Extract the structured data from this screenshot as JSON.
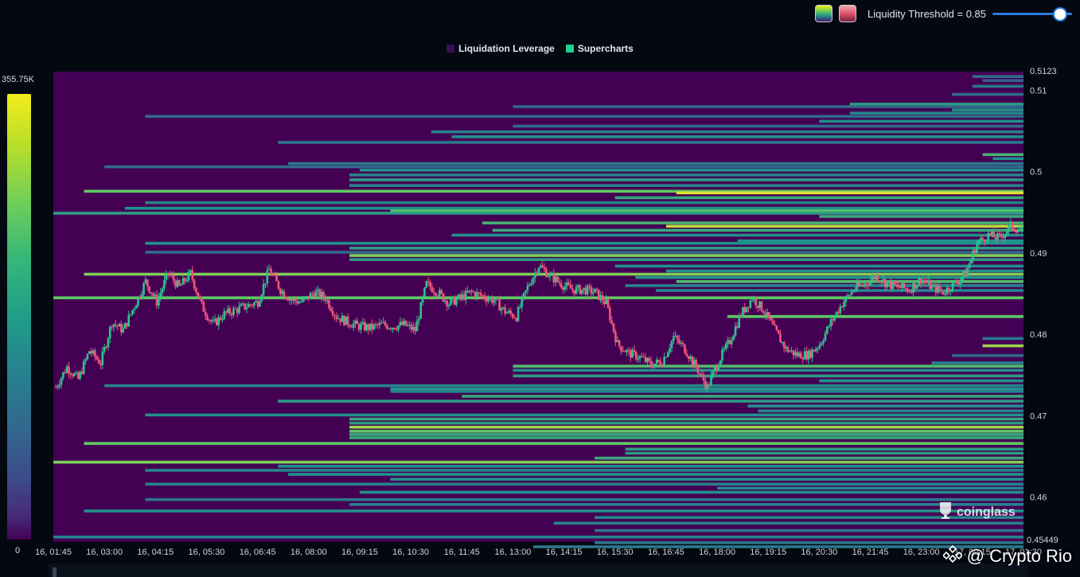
{
  "toolbar": {
    "threshold_label": "Liquidity Threshold = 0.85",
    "threshold_value": 0.85,
    "colormap_icons": [
      "viridis-colormap-icon",
      "red-colormap-icon"
    ]
  },
  "colorbar": {
    "max_label": "355.75K",
    "min_label": "0"
  },
  "watermark": "coinglass",
  "credit": "@ Crypto Rio",
  "colors": {
    "background": "#440154",
    "candle_up": "#2ec38d",
    "candle_down": "#f0567a",
    "legend_liquidation": "#3b0f57",
    "legend_supercharts": "#1fcf90"
  },
  "chart_data": {
    "type": "heatmap",
    "legend": [
      {
        "name": "Liquidation Leverage",
        "color": "#3b0f57"
      },
      {
        "name": "Supercharts",
        "color": "#1fcf90"
      }
    ],
    "x_ticks": [
      "16, 01:45",
      "16, 03:00",
      "16, 04:15",
      "16, 05:30",
      "16, 06:45",
      "16, 08:00",
      "16, 09:15",
      "16, 10:30",
      "16, 11:45",
      "16, 13:00",
      "16, 14:15",
      "16, 15:30",
      "16, 16:45",
      "16, 18:00",
      "16, 19:15",
      "16, 20:30",
      "16, 21:45",
      "16, 23:00",
      "17, 00:15",
      "17, 01:30"
    ],
    "y_ticks": [
      0.46,
      0.47,
      0.48,
      0.49,
      0.5,
      0.51
    ],
    "ylim": [
      0.45449,
      0.5123
    ],
    "y_range_labels": [
      "0.5123",
      "0.45449"
    ],
    "colorscale": {
      "min": 0,
      "max": 355750
    },
    "price_path": [
      0.4735,
      0.476,
      0.4745,
      0.478,
      0.4765,
      0.4815,
      0.4805,
      0.4835,
      0.4865,
      0.484,
      0.4875,
      0.4858,
      0.4875,
      0.4835,
      0.4812,
      0.4825,
      0.483,
      0.4835,
      0.484,
      0.488,
      0.4855,
      0.4842,
      0.484,
      0.4852,
      0.4845,
      0.4822,
      0.4815,
      0.481,
      0.4808,
      0.4812,
      0.481,
      0.4812,
      0.4805,
      0.4862,
      0.4852,
      0.4838,
      0.4845,
      0.4852,
      0.4847,
      0.4842,
      0.4828,
      0.4822,
      0.4858,
      0.4885,
      0.4872,
      0.4862,
      0.4855,
      0.4855,
      0.4852,
      0.4838,
      0.4788,
      0.4777,
      0.4772,
      0.4763,
      0.4767,
      0.4797,
      0.4782,
      0.476,
      0.4735,
      0.4767,
      0.4792,
      0.4825,
      0.4845,
      0.483,
      0.4805,
      0.4782,
      0.4775,
      0.4775,
      0.4788,
      0.4815,
      0.4838,
      0.4855,
      0.4862,
      0.4872,
      0.4862,
      0.4858,
      0.4855,
      0.4868,
      0.4858,
      0.4852,
      0.4862,
      0.4875,
      0.4912,
      0.4922,
      0.4918,
      0.4933,
      0.4928
    ],
    "liquidity_levels": [
      {
        "price": 0.5117,
        "from": "17, 00:15",
        "intensity": 0.35
      },
      {
        "price": 0.5112,
        "from": "17, 00:30",
        "intensity": 0.3
      },
      {
        "price": 0.5105,
        "from": "17, 00:15",
        "intensity": 0.4
      },
      {
        "price": 0.5095,
        "from": "16, 23:45",
        "intensity": 0.35
      },
      {
        "price": 0.5083,
        "from": "16, 21:15",
        "intensity": 0.55
      },
      {
        "price": 0.508,
        "from": "16, 13:00",
        "intensity": 0.35
      },
      {
        "price": 0.5076,
        "from": "16, 23:45",
        "intensity": 0.5
      },
      {
        "price": 0.5072,
        "from": "16, 21:15",
        "intensity": 0.45
      },
      {
        "price": 0.5068,
        "from": "16, 04:00",
        "intensity": 0.35
      },
      {
        "price": 0.5062,
        "from": "16, 20:30",
        "intensity": 0.5
      },
      {
        "price": 0.5056,
        "from": "16, 13:00",
        "intensity": 0.35
      },
      {
        "price": 0.5049,
        "from": "16, 11:00",
        "intensity": 0.45
      },
      {
        "price": 0.5043,
        "from": "16, 11:30",
        "intensity": 0.5
      },
      {
        "price": 0.5036,
        "from": "16, 07:15",
        "intensity": 0.4
      },
      {
        "price": 0.5021,
        "from": "17, 00:30",
        "intensity": 0.65
      },
      {
        "price": 0.5016,
        "from": "17, 00:45",
        "intensity": 0.5
      },
      {
        "price": 0.501,
        "from": "16, 07:30",
        "intensity": 0.4
      },
      {
        "price": 0.5006,
        "from": "16, 03:00",
        "intensity": 0.35
      },
      {
        "price": 0.5002,
        "from": "16, 09:15",
        "intensity": 0.5
      },
      {
        "price": 0.4996,
        "from": "16, 09:00",
        "intensity": 0.45
      },
      {
        "price": 0.499,
        "from": "16, 09:00",
        "intensity": 0.55
      },
      {
        "price": 0.4983,
        "from": "16, 09:00",
        "intensity": 0.45
      },
      {
        "price": 0.4976,
        "from": "16, 02:30",
        "intensity": 0.75
      },
      {
        "price": 0.4974,
        "from": "16, 17:00",
        "intensity": 0.95
      },
      {
        "price": 0.4968,
        "from": "16, 15:30",
        "intensity": 0.6
      },
      {
        "price": 0.4962,
        "from": "16, 04:00",
        "intensity": 0.45
      },
      {
        "price": 0.4955,
        "from": "16, 03:30",
        "intensity": 0.5
      },
      {
        "price": 0.4952,
        "from": "16, 10:00",
        "intensity": 0.7
      },
      {
        "price": 0.4949,
        "from": "16, 01:30",
        "intensity": 0.55
      },
      {
        "price": 0.4945,
        "from": "16, 20:30",
        "intensity": 0.6
      },
      {
        "price": 0.4937,
        "from": "16, 12:15",
        "intensity": 0.65
      },
      {
        "price": 0.4933,
        "from": "16, 16:45",
        "intensity": 0.9
      },
      {
        "price": 0.4928,
        "from": "16, 12:30",
        "intensity": 0.6
      },
      {
        "price": 0.4922,
        "from": "16, 11:30",
        "intensity": 0.5
      },
      {
        "price": 0.4915,
        "from": "16, 18:30",
        "intensity": 0.5
      },
      {
        "price": 0.4912,
        "from": "16, 04:00",
        "intensity": 0.5
      },
      {
        "price": 0.4906,
        "from": "16, 09:00",
        "intensity": 0.55
      },
      {
        "price": 0.4901,
        "from": "16, 04:00",
        "intensity": 0.35
      },
      {
        "price": 0.4897,
        "from": "16, 09:00",
        "intensity": 0.8
      },
      {
        "price": 0.4892,
        "from": "16, 09:00",
        "intensity": 0.55
      },
      {
        "price": 0.4884,
        "from": "16, 15:30",
        "intensity": 0.5
      },
      {
        "price": 0.4878,
        "from": "16, 16:45",
        "intensity": 0.5
      },
      {
        "price": 0.4874,
        "from": "16, 02:30",
        "intensity": 0.8
      },
      {
        "price": 0.487,
        "from": "16, 16:00",
        "intensity": 0.5
      },
      {
        "price": 0.4865,
        "from": "16, 17:00",
        "intensity": 0.7
      },
      {
        "price": 0.486,
        "from": "16, 15:45",
        "intensity": 0.45
      },
      {
        "price": 0.4854,
        "from": "16, 16:30",
        "intensity": 0.45
      },
      {
        "price": 0.4845,
        "from": "16, 01:45",
        "intensity": 0.75
      },
      {
        "price": 0.4822,
        "from": "16, 18:15",
        "intensity": 0.75
      },
      {
        "price": 0.4795,
        "from": "17, 00:30",
        "intensity": 0.4
      },
      {
        "price": 0.4786,
        "from": "17, 00:30",
        "intensity": 0.85
      },
      {
        "price": 0.4774,
        "from": "16, 23:45",
        "intensity": 0.35
      },
      {
        "price": 0.4765,
        "from": "16, 23:15",
        "intensity": 0.45
      },
      {
        "price": 0.4761,
        "from": "16, 13:00",
        "intensity": 0.7
      },
      {
        "price": 0.4756,
        "from": "16, 13:00",
        "intensity": 0.5
      },
      {
        "price": 0.4749,
        "from": "16, 13:00",
        "intensity": 0.55
      },
      {
        "price": 0.4743,
        "from": "16, 20:30",
        "intensity": 0.5
      },
      {
        "price": 0.4737,
        "from": "16, 03:00",
        "intensity": 0.45
      },
      {
        "price": 0.4733,
        "from": "16, 10:00",
        "intensity": 0.5
      },
      {
        "price": 0.473,
        "from": "16, 10:00",
        "intensity": 0.45
      },
      {
        "price": 0.4724,
        "from": "16, 11:45",
        "intensity": 0.6
      },
      {
        "price": 0.4718,
        "from": "16, 07:15",
        "intensity": 0.55
      },
      {
        "price": 0.4712,
        "from": "16, 18:45",
        "intensity": 0.5
      },
      {
        "price": 0.4706,
        "from": "16, 19:00",
        "intensity": 0.45
      },
      {
        "price": 0.4701,
        "from": "16, 04:00",
        "intensity": 0.5
      },
      {
        "price": 0.4696,
        "from": "16, 09:00",
        "intensity": 0.6
      },
      {
        "price": 0.4691,
        "from": "16, 09:00",
        "intensity": 0.55
      },
      {
        "price": 0.4686,
        "from": "16, 09:00",
        "intensity": 0.85
      },
      {
        "price": 0.4681,
        "from": "16, 09:00",
        "intensity": 0.75
      },
      {
        "price": 0.4677,
        "from": "16, 09:00",
        "intensity": 0.6
      },
      {
        "price": 0.4673,
        "from": "16, 09:00",
        "intensity": 0.6
      },
      {
        "price": 0.4666,
        "from": "16, 02:30",
        "intensity": 0.75
      },
      {
        "price": 0.4659,
        "from": "16, 15:45",
        "intensity": 0.55
      },
      {
        "price": 0.4654,
        "from": "16, 15:45",
        "intensity": 0.55
      },
      {
        "price": 0.4648,
        "from": "16, 15:00",
        "intensity": 0.6
      },
      {
        "price": 0.4643,
        "from": "16, 01:45",
        "intensity": 0.8
      },
      {
        "price": 0.4638,
        "from": "16, 07:15",
        "intensity": 0.5
      },
      {
        "price": 0.4633,
        "from": "16, 04:00",
        "intensity": 0.45
      },
      {
        "price": 0.4628,
        "from": "16, 07:30",
        "intensity": 0.5
      },
      {
        "price": 0.4622,
        "from": "16, 10:00",
        "intensity": 0.5
      },
      {
        "price": 0.4616,
        "from": "16, 04:00",
        "intensity": 0.45
      },
      {
        "price": 0.4611,
        "from": "16, 18:00",
        "intensity": 0.45
      },
      {
        "price": 0.4606,
        "from": "16, 09:15",
        "intensity": 0.5
      },
      {
        "price": 0.4597,
        "from": "16, 04:00",
        "intensity": 0.4
      },
      {
        "price": 0.4591,
        "from": "16, 09:00",
        "intensity": 0.45
      },
      {
        "price": 0.4583,
        "from": "16, 02:30",
        "intensity": 0.5
      },
      {
        "price": 0.4575,
        "from": "16, 15:00",
        "intensity": 0.45
      },
      {
        "price": 0.4568,
        "from": "16, 14:00",
        "intensity": 0.45
      },
      {
        "price": 0.4559,
        "from": "16, 15:00",
        "intensity": 0.4
      },
      {
        "price": 0.4551,
        "from": "16, 01:45",
        "intensity": 0.45
      },
      {
        "price": 0.4544,
        "from": "16, 15:00",
        "intensity": 0.4
      },
      {
        "price": 0.4539,
        "from": "16, 13:30",
        "intensity": 0.4
      }
    ]
  }
}
